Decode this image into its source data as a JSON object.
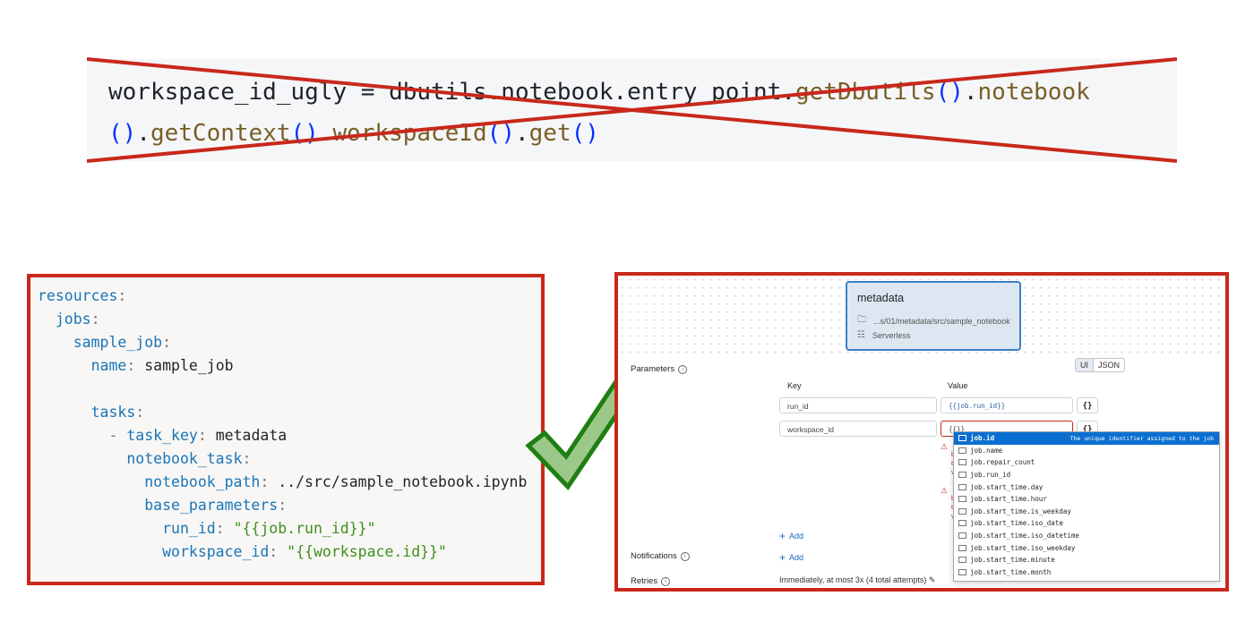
{
  "top_code": {
    "line1_plain": "workspace_id_ugly = dbutils.notebook.entry_point.",
    "line1_fn": "getDbutils",
    "line1_paren": "()",
    "line1_dot": ".",
    "line1_fn2": "notebook",
    "line2_paren1": "()",
    "line2_dot1": ".",
    "line2_fn1": "getContext",
    "line2_paren2": "()",
    "line2_dot2": ".",
    "line2_fn2": "workspaceId",
    "line2_paren3": "()",
    "line2_dot3": ".",
    "line2_fn3": "get",
    "line2_paren4": "()",
    "cross_color": "#c8281c"
  },
  "yaml": {
    "l1_key": "resources",
    "colon": ":",
    "l2_key": "jobs",
    "l3_key": "sample_job",
    "l4_key": "name",
    "l4_val": "sample_job",
    "l5_key": "tasks",
    "l6_dash": "- ",
    "l6_key": "task_key",
    "l6_val": "metadata",
    "l7_key": "notebook_task",
    "l8_key": "notebook_path",
    "l8_val": "../src/sample_notebook.ipynb",
    "l9_key": "base_parameters",
    "l10_key": "run_id",
    "l10_val": "\"{{job.run_id}}\"",
    "l11_key": "workspace_id",
    "l11_val": "\"{{workspace.id}}\""
  },
  "checkmark": {
    "fill": "#9cc88a",
    "stroke": "#1f7f12"
  },
  "ui": {
    "task_card": {
      "title": "metadata",
      "path": "...s/01/metadata/src/sample_notebook",
      "compute": "Serverless"
    },
    "parameters_label": "Parameters",
    "toggle": {
      "ui": "UI",
      "json": "JSON"
    },
    "col_key": "Key",
    "col_value": "Value",
    "rows": [
      {
        "key": "run_id",
        "value": "{{job.run_id}}",
        "brace": "{}"
      },
      {
        "key": "workspace_id",
        "value": "{{}}",
        "brace": "{}"
      }
    ],
    "warn_icon": "⚠",
    "add_label": "Add",
    "notifications_label": "Notifications",
    "retries_label": "Retries",
    "retries_value": "Immediately, at most 3x (4 total attempts)",
    "autocomplete": {
      "items": [
        "job.id",
        "job.name",
        "job.repair_count",
        "job.run_id",
        "job.start_time.day",
        "job.start_time.hour",
        "job.start_time.is_weekday",
        "job.start_time.iso_date",
        "job.start_time.iso_datetime",
        "job.start_time.iso_weekday",
        "job.start_time.minute",
        "job.start_time.month"
      ],
      "selected_index": 0,
      "selected_desc": "The unique identifier assigned to the job"
    }
  }
}
